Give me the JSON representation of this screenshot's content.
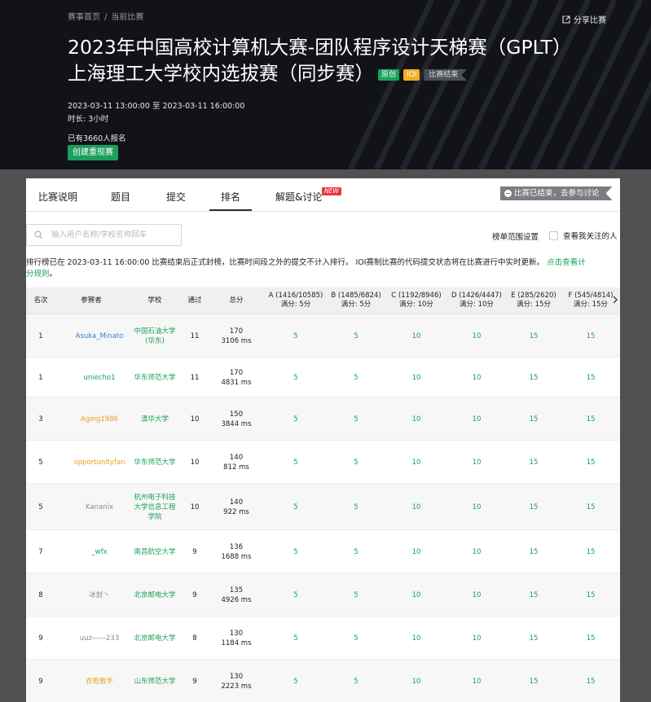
{
  "header": {
    "breadcrumb": [
      "赛事首页",
      "当前比赛"
    ],
    "share_label": "分享比赛",
    "title_line1": "2023年中国高校计算机大赛-团队程序设计天梯赛（GPLT）",
    "title_line2": "上海理工大学校内选拔赛（同步赛）",
    "tags": [
      "原创",
      "IOI",
      "比赛结束"
    ],
    "time_start": "2023-03-11 13:00:00",
    "time_sep": "至",
    "time_end": "2023-03-11 16:00:00",
    "duration": "时长: 3小时",
    "registered": "已有3660人报名",
    "cta_label": "创建重现赛"
  },
  "tabs": [
    "比赛说明",
    "题目",
    "提交",
    "排名",
    "解题&讨论"
  ],
  "active_tab": "排名",
  "new_badge": "NEW",
  "ended_banner": "比赛已结束，去参与讨论",
  "search": {
    "placeholder": "输入用户名称/学校名称回车"
  },
  "range_label": "榜单范围设置",
  "follow_label": "查看我关注的人",
  "notice": {
    "text": "排行榜已在 2023-03-11 16:00:00 比赛结束后正式封榜，比赛时间段之外的提交不计入排行。 IOI赛制比赛的代码提交状态将在比赛进行中实时更新。",
    "link_part1": "点击查看计",
    "link_part2": "分规则",
    "tail": "。"
  },
  "table": {
    "headers": {
      "rank": "名次",
      "name": "参赛者",
      "school": "学校",
      "solved": "通过",
      "score": "总分"
    },
    "problems": [
      {
        "label": "A (1416/10585)",
        "full": "满分: 5分"
      },
      {
        "label": "B (1485/6824)",
        "full": "满分: 5分"
      },
      {
        "label": "C (1192/8946)",
        "full": "满分: 10分"
      },
      {
        "label": "D (1426/4447)",
        "full": "满分: 10分"
      },
      {
        "label": "E (285/2620)",
        "full": "满分: 15分"
      },
      {
        "label": "F (545/4814)",
        "full": "满分: 15分"
      }
    ],
    "rows": [
      {
        "rank": "1",
        "name": "Asuka_Minato",
        "name_color": "blue",
        "school": [
          "中国石油大学",
          "(华东)"
        ],
        "solved": "11",
        "score": "170",
        "time": "3106 ms",
        "scores": [
          "5",
          "5",
          "10",
          "10",
          "15",
          "15"
        ]
      },
      {
        "rank": "1",
        "name": "uniecho1",
        "name_color": "green",
        "school": [
          "华东师范大学"
        ],
        "solved": "11",
        "score": "170",
        "time": "4831 ms",
        "scores": [
          "5",
          "5",
          "10",
          "10",
          "15",
          "15"
        ]
      },
      {
        "rank": "3",
        "name": "Aging1986",
        "name_color": "yellow",
        "school": [
          "清华大学"
        ],
        "solved": "10",
        "score": "150",
        "time": "3844 ms",
        "scores": [
          "5",
          "5",
          "10",
          "10",
          "15",
          "15"
        ]
      },
      {
        "rank": "5",
        "name": "opportunityfan",
        "name_color": "yellow",
        "school": [
          "华东师范大学"
        ],
        "solved": "10",
        "score": "140",
        "time": "812 ms",
        "scores": [
          "5",
          "5",
          "10",
          "10",
          "15",
          "15"
        ]
      },
      {
        "rank": "5",
        "name": "Kananix",
        "name_color": "gray",
        "school": [
          "杭州电子科技",
          "大学信息工程",
          "学院"
        ],
        "solved": "10",
        "score": "140",
        "time": "922 ms",
        "scores": [
          "5",
          "5",
          "10",
          "10",
          "15",
          "15"
        ]
      },
      {
        "rank": "7",
        "name": "_wfx",
        "name_color": "green",
        "school": [
          "南昌航空大学"
        ],
        "solved": "9",
        "score": "136",
        "time": "1688 ms",
        "scores": [
          "5",
          "5",
          "10",
          "10",
          "15",
          "15"
        ]
      },
      {
        "rank": "8",
        "name": "冰封丶",
        "name_color": "gray",
        "school": [
          "北京邮电大学"
        ],
        "solved": "9",
        "score": "135",
        "time": "4926 ms",
        "scores": [
          "5",
          "5",
          "10",
          "10",
          "15",
          "15"
        ]
      },
      {
        "rank": "9",
        "name": "uuz——233",
        "name_color": "gray",
        "school": [
          "北京邮电大学"
        ],
        "solved": "8",
        "score": "130",
        "time": "1184 ms",
        "scores": [
          "5",
          "5",
          "10",
          "10",
          "15",
          "15"
        ]
      },
      {
        "rank": "9",
        "name": "衣柜救手",
        "name_color": "yellow",
        "school": [
          "山东师范大学"
        ],
        "solved": "9",
        "score": "130",
        "time": "2223 ms",
        "scores": [
          "5",
          "5",
          "10",
          "10",
          "15",
          "15"
        ]
      }
    ]
  }
}
